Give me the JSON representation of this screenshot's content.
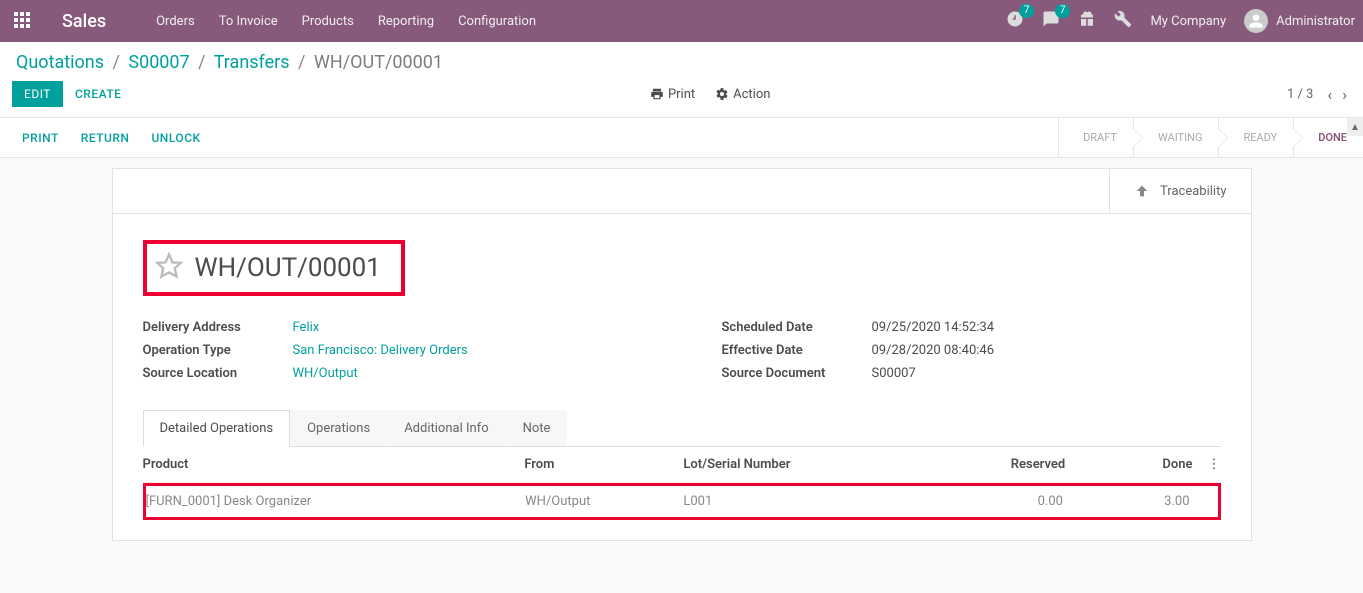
{
  "navbar": {
    "app_title": "Sales",
    "links": [
      "Orders",
      "To Invoice",
      "Products",
      "Reporting",
      "Configuration"
    ],
    "badge1": "7",
    "badge2": "7",
    "company": "My Company",
    "user": "Administrator"
  },
  "breadcrumbs": {
    "items": [
      "Quotations",
      "S00007",
      "Transfers"
    ],
    "current": "WH/OUT/00001"
  },
  "controls": {
    "edit": "EDIT",
    "create": "CREATE",
    "print": "Print",
    "action": "Action",
    "pager": "1 / 3"
  },
  "statusbar": {
    "actions": [
      "PRINT",
      "RETURN",
      "UNLOCK"
    ],
    "stages": [
      "DRAFT",
      "WAITING",
      "READY",
      "DONE"
    ],
    "active_stage": 3
  },
  "sheet": {
    "stat_button": "Traceability",
    "title": "WH/OUT/00001",
    "fields_left": {
      "delivery_address_label": "Delivery Address",
      "delivery_address": "Felix",
      "operation_type_label": "Operation Type",
      "operation_type": "San Francisco: Delivery Orders",
      "source_location_label": "Source Location",
      "source_location": "WH/Output"
    },
    "fields_right": {
      "scheduled_date_label": "Scheduled Date",
      "scheduled_date": "09/25/2020 14:52:34",
      "effective_date_label": "Effective Date",
      "effective_date": "09/28/2020 08:40:46",
      "source_document_label": "Source Document",
      "source_document": "S00007"
    },
    "tabs": [
      "Detailed Operations",
      "Operations",
      "Additional Info",
      "Note"
    ],
    "table": {
      "headers": {
        "product": "Product",
        "from": "From",
        "lot": "Lot/Serial Number",
        "reserved": "Reserved",
        "done": "Done"
      },
      "rows": [
        {
          "product": "[FURN_0001] Desk Organizer",
          "from": "WH/Output",
          "lot": "L001",
          "reserved": "0.00",
          "done": "3.00"
        }
      ]
    }
  }
}
